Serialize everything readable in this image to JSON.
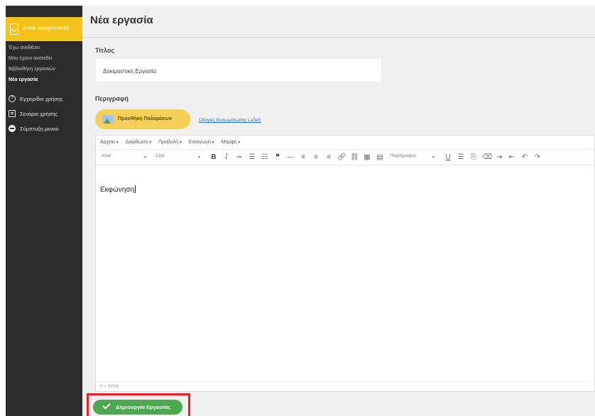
{
  "sidebar": {
    "brand_label": "e-me assignments",
    "sub_items": [
      "Έχω αναθέσει",
      "Μου έχουν ανατεθεί",
      "Βιβλιοθήκη εργασιών",
      "Νέα εργασία"
    ],
    "nav": [
      {
        "label": "Εγχειρίδιο χρήσης",
        "icon": "help-circle-icon"
      },
      {
        "label": "Σενάριο χρήσης",
        "icon": "document-icon"
      },
      {
        "label": "Σύμπτυξη μενού",
        "icon": "collapse-circle-icon"
      }
    ]
  },
  "page": {
    "title": "Νέα εργασία"
  },
  "form": {
    "title_label": "Τίτλος",
    "title_value": "Δοκιμαστική Εργασία",
    "description_label": "Περιγραφή",
    "add_media_label": "Προσθήκη Πολυμέσων",
    "latex_link": "Οδηγίες Ενσωμάτωσης LaTeX"
  },
  "editor": {
    "menus": [
      "Αρχείο",
      "Διόρθωση",
      "Προβολή",
      "Εισαγωγή",
      "Μορφή"
    ],
    "font_family": "Arial",
    "font_size": "12pt",
    "block_format": "Παράγραφος",
    "content": "Εκφώνηση",
    "path": "P » SPAN"
  },
  "actions": {
    "create_label": "Δημιουργία Εργασίας"
  },
  "colors": {
    "brand": "#f3c21b",
    "sidebar": "#2b2b2b",
    "create": "#4ba84e",
    "highlight": "#e3242b"
  }
}
